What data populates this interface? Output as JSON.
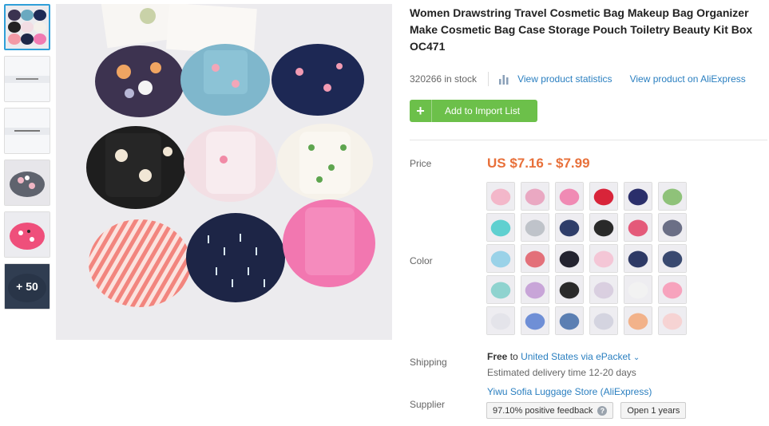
{
  "thumbnails": [
    {
      "kind": "bags-grid",
      "active": true
    },
    {
      "kind": "size-chart"
    },
    {
      "kind": "show-details"
    },
    {
      "kind": "gray-floral"
    },
    {
      "kind": "pink-flamingo"
    },
    {
      "kind": "navy-more",
      "more_label": "+ 50"
    }
  ],
  "product": {
    "title": "Women Drawstring Travel Cosmetic Bag Makeup Bag Organizer Make Cosmetic Bag Case Storage Pouch Toiletry Beauty Kit Box OC471",
    "stock_text": "320266 in stock",
    "stats_link": "View product statistics",
    "aliexpress_link": "View product on AliExpress",
    "add_button": "Add to Import List",
    "price_label": "Price",
    "price": "US $7.16 - $7.99",
    "color_label": "Color",
    "shipping_label": "Shipping",
    "shipping_free": "Free",
    "shipping_to": "to",
    "shipping_dest": "United States via ePacket",
    "delivery": "Estimated delivery time 12-20 days",
    "supplier_label": "Supplier",
    "supplier_name": "Yiwu Sofia Luggage Store (AliExpress)",
    "feedback": "97.10% positive feedback",
    "open_years": "Open 1 years"
  },
  "colors": {
    "accent_green": "#6cc04a",
    "link_blue": "#2a7fc0",
    "price_orange": "#e8703a",
    "active_border": "#2f9fd8"
  },
  "swatches": [
    {
      "color": "#f3b7c9"
    },
    {
      "color": "#e9a8c2"
    },
    {
      "color": "#f08ab4"
    },
    {
      "color": "#d8243a"
    },
    {
      "color": "#2b2f6b"
    },
    {
      "color": "#8fc27a"
    },
    {
      "color": "#5fd0d0"
    },
    {
      "color": "#bfc3c9"
    },
    {
      "color": "#2f3e6a"
    },
    {
      "color": "#2a2a2a"
    },
    {
      "color": "#e45a7a"
    },
    {
      "color": "#6b6f86"
    },
    {
      "color": "#9ad2e8"
    },
    {
      "color": "#e3707a"
    },
    {
      "color": "#242430"
    },
    {
      "color": "#f4c6d6"
    },
    {
      "color": "#2e3a66"
    },
    {
      "color": "#3a4a70"
    },
    {
      "color": "#8fd3cf"
    },
    {
      "color": "#c8a5d8"
    },
    {
      "color": "#2b2b2b"
    },
    {
      "color": "#d9cfe0"
    },
    {
      "color": "#f2f2f2"
    },
    {
      "color": "#f7a3bd"
    },
    {
      "color": "#e4e4ea"
    },
    {
      "color": "#6f8fd6"
    },
    {
      "color": "#5b7fb3"
    },
    {
      "color": "#d4d4e0"
    },
    {
      "color": "#f2b28a"
    },
    {
      "color": "#f6d3d3"
    }
  ]
}
